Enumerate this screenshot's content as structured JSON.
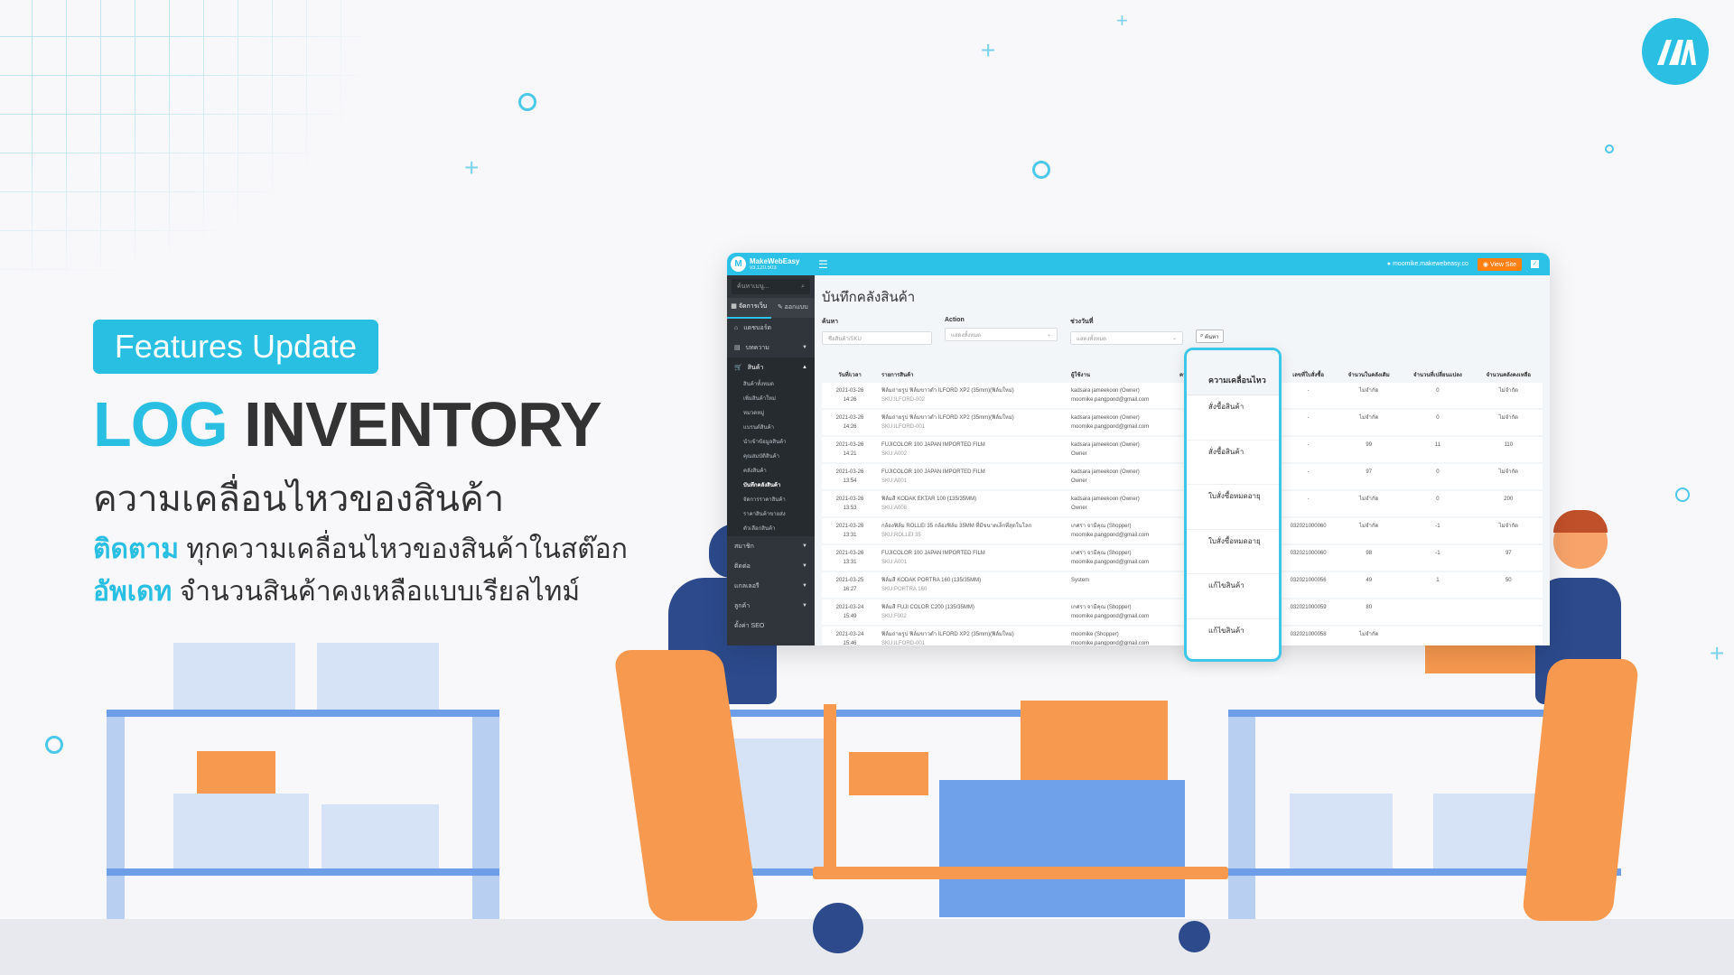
{
  "banner": {
    "badge": "Features Update",
    "title_highlight": "LOG",
    "title_rest": "INVENTORY",
    "subtitle": "ความเคลื่อนไหวของสินค้า",
    "lines": [
      {
        "highlight": "ติดตาม",
        "text": "ทุกความเคลื่อนไหวของสินค้าในสต๊อก"
      },
      {
        "highlight": "อัพเดท",
        "text": "จำนวนสินค้าคงเหลือแบบเรียลไทม์"
      }
    ],
    "logo_icon": "makewebeasy-logo-icon",
    "colors": {
      "accent": "#29bfe2",
      "text": "#333333",
      "orange": "#f7994f",
      "navy": "#2c4a8c"
    }
  },
  "app": {
    "brand": "MakeWebEasy",
    "version": "v3.120.503",
    "site": "moomike.makewebeasy.co",
    "view_site": "View Site",
    "sidebar": {
      "search_placeholder": "ค้นหาเมนู...",
      "tabs": [
        "จัดการเว็บ",
        "ออกแบบ"
      ],
      "items": [
        {
          "label": "แดชบอร์ด",
          "icon": "dashboard-icon"
        },
        {
          "label": "บทความ",
          "icon": "article-icon"
        },
        {
          "label": "สินค้า",
          "icon": "cart-icon"
        }
      ],
      "sub_items": [
        "สินค้าทั้งหมด",
        "เพิ่มสินค้าใหม่",
        "หมวดหมู่",
        "แบรนด์สินค้า",
        "นำเข้าข้อมูลสินค้า",
        "คุณสมบัติสินค้า",
        "คลังสินค้า",
        "บันทึกคลังสินค้า",
        "จัดการราคาสินค้า",
        "ราคาสินค้าขายส่ง",
        "ตัวเลือกสินค้า"
      ],
      "current": "บันทึกคลังสินค้า",
      "more_items": [
        "สมาชิก",
        "ติดต่อ",
        "แกลเลอรี",
        "ลูกค้า",
        "ตั้งค่า SEO"
      ]
    },
    "page_title": "บันทึกคลังสินค้า",
    "filters": {
      "search_label": "ค้นหา",
      "search_placeholder": "ชื่อสินค้า/SKU",
      "action_label": "Action",
      "action_value": "แสดงทั้งหมด",
      "range_label": "ช่วงวันที่",
      "range_value": "แสดงทั้งหมด",
      "search_button": "ค้นหา"
    },
    "columns": [
      "วันที่/เวลา",
      "รายการสินค้า",
      "ผู้ใช้งาน",
      "ความเคลื่อนไหว",
      "เลขที่ใบสั่งซื้อ",
      "จำนวนในคลังเดิม",
      "จำนวนที่เปลี่ยนแปลง",
      "จำนวนคลังคงเหลือ"
    ],
    "rows": [
      {
        "date": "2021-03-26",
        "time": "14:26",
        "product": "ฟิล์มถ่ายรูป ฟิล์มขาวดำ ILFORD XP2 (35mm)(ฟิล์มใหม่)",
        "sku": "SKU:ILFORD-002",
        "user": "kadsara jameekoon (Owner)",
        "user2": "moomike.pangpond@gmail.com",
        "order": "-",
        "before": "ไม่จำกัด",
        "change": "0",
        "after": "ไม่จำกัด"
      },
      {
        "date": "2021-03-26",
        "time": "14:26",
        "product": "ฟิล์มถ่ายรูป ฟิล์มขาวดำ ILFORD XP2 (35mm)(ฟิล์มใหม่)",
        "sku": "SKU:ILFORD-001",
        "user": "kadsara jameekoon (Owner)",
        "user2": "moomike.pangpond@gmail.com",
        "order": "-",
        "before": "ไม่จำกัด",
        "change": "0",
        "after": "ไม่จำกัด"
      },
      {
        "date": "2021-03-26",
        "time": "14:21",
        "product": "FUJICOLOR 100 JAPAN IMPORTED FILM",
        "sku": "SKU:A002",
        "user": "kadsara jameekoon (Owner)",
        "user2": "Owner",
        "order": "-",
        "before": "99",
        "change": "11",
        "after": "110"
      },
      {
        "date": "2021-03-26",
        "time": "13:54",
        "product": "FUJICOLOR 100 JAPAN IMPORTED FILM",
        "sku": "SKU:A001",
        "user": "kadsara jameekoon (Owner)",
        "user2": "Owner",
        "order": "-",
        "before": "97",
        "change": "0",
        "after": "ไม่จำกัด"
      },
      {
        "date": "2021-03-26",
        "time": "13:53",
        "product": "ฟิล์มสี KODAK EKTAR 100 (135/35MM)",
        "sku": "SKU:A008",
        "user": "kadsara jameekoon (Owner)",
        "user2": "Owner",
        "order": "-",
        "before": "ไม่จำกัด",
        "change": "0",
        "after": "200"
      },
      {
        "date": "2021-03-26",
        "time": "13:31",
        "product": "กล้องฟิล์ม ROLLEI 35 กล้องฟิล์ม 35MM ที่มีขนาดเล็กที่สุดในโลก",
        "sku": "SKU:ROLLEI 35",
        "user": "เกศรา จามีคุณ (Shopper)",
        "user2": "moomike.pangpond@gmail.com",
        "order": "032021000060",
        "before": "ไม่จำกัด",
        "change": "-1",
        "after": "ไม่จำกัด"
      },
      {
        "date": "2021-03-26",
        "time": "13:31",
        "product": "FUJICOLOR 100 JAPAN IMPORTED FILM",
        "sku": "SKU:A001",
        "user": "เกศรา จามีคุณ (Shopper)",
        "user2": "moomike.pangpond@gmail.com",
        "order": "032021000060",
        "before": "98",
        "change": "-1",
        "after": "97"
      },
      {
        "date": "2021-03-25",
        "time": "16:27",
        "product": "ฟิล์มสี KODAK PORTRA 160 (135/35MM)",
        "sku": "SKU:PORTRA 160",
        "user": "System",
        "user2": "",
        "order": "032021000056",
        "before": "49",
        "change": "1",
        "after": "50"
      },
      {
        "date": "2021-03-24",
        "time": "15:49",
        "product": "ฟิล์มสี FUJI COLOR C200 (135/35MM)",
        "sku": "SKU:F002",
        "user": "เกศรา จามีคุณ (Shopper)",
        "user2": "moomike.pangpond@gmail.com",
        "order": "032021000059",
        "before": "80",
        "change": "",
        "after": ""
      },
      {
        "date": "2021-03-24",
        "time": "15:46",
        "product": "ฟิล์มถ่ายรูป ฟิล์มขาวดำ ILFORD XP2 (35mm)(ฟิล์มใหม่)",
        "sku": "SKU:ILFORD-001",
        "user": "moomike (Shopper)",
        "user2": "moomike.pangpond@gmail.com",
        "order": "032021000058",
        "before": "ไม่จำกัด",
        "change": "",
        "after": ""
      }
    ],
    "highlight_card": {
      "header": "ความเคลื่อนไหว",
      "items": [
        "สั่งซื้อสินค้า",
        "สั่งซื้อสินค้า",
        "ใบสั่งซื้อหมดอายุ",
        "ใบสั่งซื้อหมดอายุ",
        "แก้ไขสินค้า",
        "แก้ไขสินค้า"
      ]
    }
  }
}
